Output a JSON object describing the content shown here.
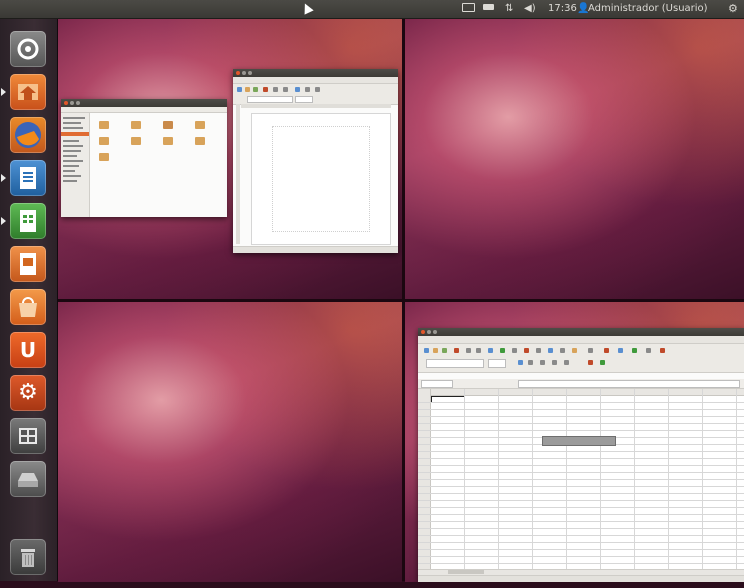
{
  "top_panel": {
    "clock": "17:36",
    "user": "Administrador (Usuario)"
  },
  "launcher": {
    "items": [
      {
        "name": "dash-home",
        "icon": "ubuntu-logo-icon",
        "color": "#6d6d6d"
      },
      {
        "name": "home-folder",
        "icon": "home-folder-icon",
        "color": "#e0691f"
      },
      {
        "name": "firefox",
        "icon": "firefox-icon",
        "color": "#2f5aa8"
      },
      {
        "name": "libreoffice-writer",
        "icon": "writer-icon",
        "color": "#2b72b8"
      },
      {
        "name": "libreoffice-calc",
        "icon": "calc-icon",
        "color": "#3f9a3b"
      },
      {
        "name": "libreoffice-impress",
        "icon": "impress-icon",
        "color": "#d2661f"
      },
      {
        "name": "ubuntu-software-center",
        "icon": "software-center-icon",
        "color": "#e06b1a"
      },
      {
        "name": "ubuntu-one",
        "icon": "ubuntu-one-icon",
        "color": "#d9501c"
      },
      {
        "name": "system-settings",
        "icon": "settings-icon",
        "color": "#c64a1e"
      },
      {
        "name": "workspace-switcher",
        "icon": "workspace-switcher-icon",
        "color": "#5a5a5a"
      },
      {
        "name": "drive",
        "icon": "drive-icon",
        "color": "#6f6f6f"
      },
      {
        "name": "trash",
        "icon": "trash-icon",
        "color": "#555555"
      }
    ]
  },
  "colors": {
    "panel": "#3c3b37",
    "launcher": "#2f252b",
    "wallpaper_dark": "#4a1230",
    "wallpaper_light": "#e8a0b0",
    "accent": "#dd4814"
  },
  "calc_window": {
    "tooltip": ""
  }
}
